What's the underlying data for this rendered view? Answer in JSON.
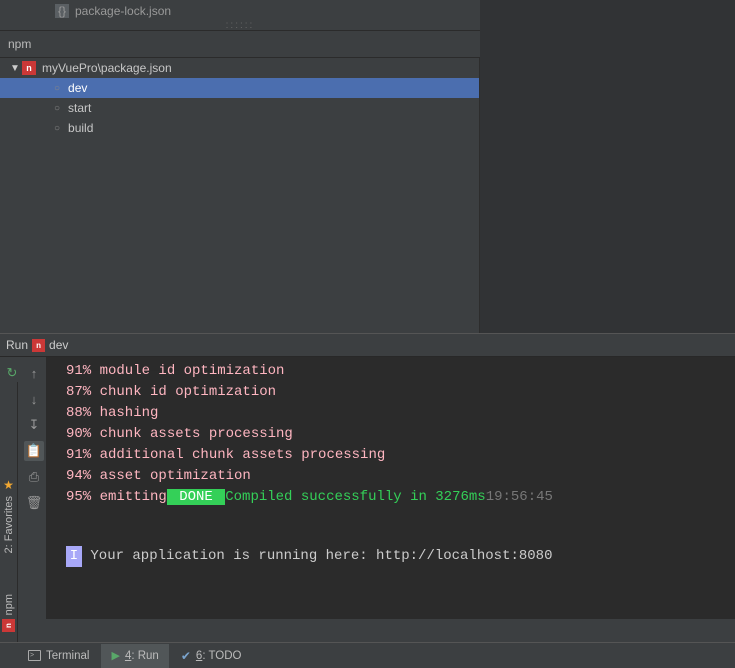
{
  "top_row": {
    "truncated_label": "package-lock.json"
  },
  "npm_panel": {
    "title": "npm",
    "root": "myVuePro\\package.json",
    "scripts": [
      {
        "label": "dev",
        "selected": true
      },
      {
        "label": "start",
        "selected": false
      },
      {
        "label": "build",
        "selected": false
      }
    ],
    "toolbar_icons": {
      "add": "+",
      "remove": "−",
      "refresh": "⟳",
      "collapse": "⇥",
      "sep": "|",
      "settings": "⚙",
      "hide": "⇤"
    }
  },
  "run_panel": {
    "header_prefix": "Run",
    "header_script": "dev",
    "gutter": {
      "rerun": "↻",
      "stop": "■",
      "up": "↑",
      "down": "↓",
      "wrap": "≣",
      "scroll": "↧",
      "print": "⎙",
      "pin": "✦",
      "close": "✖",
      "trash": "🗑",
      "help": "?",
      "clip": "📋"
    },
    "console": {
      "l0": "91% module id optimization",
      "l1": "87% chunk id optimization",
      "l2": "88% hashing",
      "l3": "90% chunk assets processing",
      "l4": "91% additional chunk assets processing",
      "l5": "94% asset optimization",
      "l6_pre": "95% emitting",
      "l6_done": " DONE ",
      "l6_msg": "Compiled successfully in 3276ms",
      "l6_time": "19:56:45",
      "info_badge": "I",
      "info_msg": " Your application is running here: http://localhost:8080"
    }
  },
  "left_bar": {
    "favorites": "2: Favorites",
    "npm_label": "npm"
  },
  "bottom_bar": {
    "terminal": "Terminal",
    "run_num": "4",
    "run_label": ": Run",
    "todo_num": "6",
    "todo_label": ": TODO"
  }
}
